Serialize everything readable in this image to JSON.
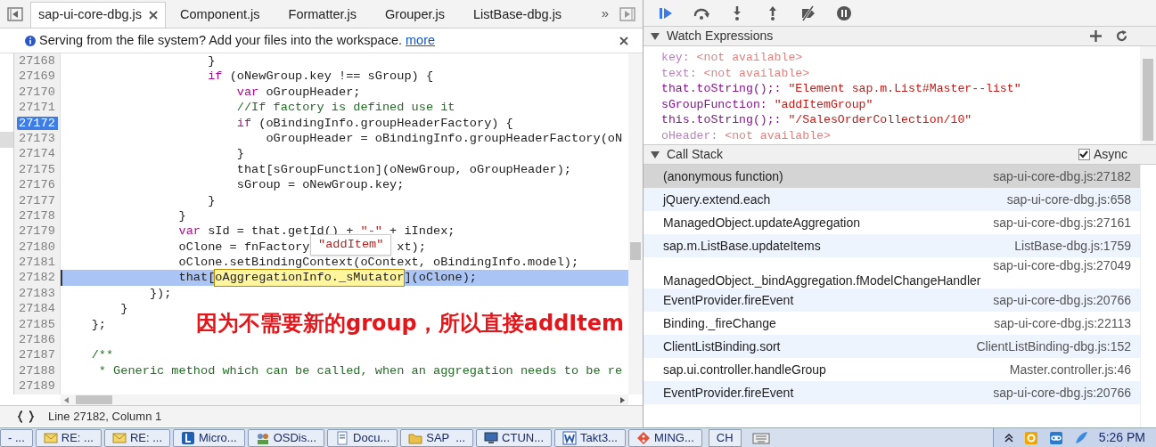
{
  "tabs": [
    {
      "label": "sap-ui-core-dbg.js",
      "selected": true
    },
    {
      "label": "Component.js",
      "selected": false
    },
    {
      "label": "Formatter.js",
      "selected": false
    },
    {
      "label": "Grouper.js",
      "selected": false
    },
    {
      "label": "ListBase-dbg.js",
      "selected": false
    }
  ],
  "tab_overflow": "»",
  "info_bar": {
    "text": "Serving from the file system? Add your files into the workspace.",
    "link": "more"
  },
  "code": {
    "lines": [
      {
        "number": "27168",
        "breakpoint": false,
        "current": false,
        "segments": [
          {
            "t": "                    }",
            "kind": "plain"
          }
        ]
      },
      {
        "number": "27169",
        "breakpoint": false,
        "current": false,
        "segments": [
          {
            "t": "                    if",
            "kind": "keyword"
          },
          {
            "t": " (oNewGroup.key !== sGroup) {",
            "kind": "plain"
          }
        ]
      },
      {
        "number": "27170",
        "breakpoint": false,
        "current": false,
        "segments": [
          {
            "t": "                        var",
            "kind": "keyword"
          },
          {
            "t": " oGroupHeader;",
            "kind": "plain"
          }
        ]
      },
      {
        "number": "27171",
        "breakpoint": false,
        "current": false,
        "segments": [
          {
            "t": "                        //If factory is defined use it",
            "kind": "comment"
          }
        ]
      },
      {
        "number": "27172",
        "breakpoint": true,
        "current": false,
        "segments": [
          {
            "t": "                        if",
            "kind": "keyword"
          },
          {
            "t": " (oBindingInfo.groupHeaderFactory) {",
            "kind": "plain"
          }
        ]
      },
      {
        "number": "27173",
        "breakpoint": false,
        "current": false,
        "segments": [
          {
            "t": "                            oGroupHeader = oBindingInfo.groupHeaderFactory(oN",
            "kind": "plain"
          }
        ]
      },
      {
        "number": "27174",
        "breakpoint": false,
        "current": false,
        "segments": [
          {
            "t": "                        }",
            "kind": "plain"
          }
        ]
      },
      {
        "number": "27175",
        "breakpoint": false,
        "current": false,
        "segments": [
          {
            "t": "                        that[sGroupFunction](oNewGroup, oGroupHeader);",
            "kind": "plain"
          }
        ]
      },
      {
        "number": "27176",
        "breakpoint": false,
        "current": false,
        "segments": [
          {
            "t": "                        sGroup = oNewGroup.key;",
            "kind": "plain"
          }
        ]
      },
      {
        "number": "27177",
        "breakpoint": false,
        "current": false,
        "segments": [
          {
            "t": "                    }",
            "kind": "plain"
          }
        ]
      },
      {
        "number": "27178",
        "breakpoint": false,
        "current": false,
        "segments": [
          {
            "t": "                }",
            "kind": "plain"
          }
        ]
      },
      {
        "number": "27179",
        "breakpoint": false,
        "current": false,
        "segments": [
          {
            "t": "                var",
            "kind": "keyword"
          },
          {
            "t": " sId = that.getId() + ",
            "kind": "plain"
          },
          {
            "t": "\"-\"",
            "kind": "string"
          },
          {
            "t": " + iIndex;",
            "kind": "plain"
          }
        ]
      },
      {
        "number": "27180",
        "breakpoint": false,
        "current": false,
        "popup": "\"addItem\"",
        "segments": [
          {
            "t": "                oClone = fnFactory",
            "kind": "plain"
          },
          {
            "t": "xt);",
            "kind": "plain",
            "covered": true
          }
        ]
      },
      {
        "number": "27181",
        "breakpoint": false,
        "current": false,
        "segments": [
          {
            "t": "                oClone.setBindingContext(oContext, oBindingInfo.model);",
            "kind": "plain"
          }
        ]
      },
      {
        "number": "27182",
        "breakpoint": false,
        "current": true,
        "segments": [
          {
            "t": "                that[",
            "kind": "plain"
          },
          {
            "t": "oAggregationInfo._sMutator",
            "kind": "highlight"
          },
          {
            "t": "](oClone);",
            "kind": "plain"
          }
        ]
      },
      {
        "number": "27183",
        "breakpoint": false,
        "current": false,
        "segments": [
          {
            "t": "            });",
            "kind": "plain"
          }
        ]
      },
      {
        "number": "27184",
        "breakpoint": false,
        "current": false,
        "segments": [
          {
            "t": "        }",
            "kind": "plain"
          }
        ]
      },
      {
        "number": "27185",
        "breakpoint": false,
        "current": false,
        "segments": [
          {
            "t": "    };",
            "kind": "plain"
          }
        ]
      },
      {
        "number": "27186",
        "breakpoint": false,
        "current": false
      },
      {
        "number": "27187",
        "breakpoint": false,
        "current": false,
        "segments": [
          {
            "t": "    /**",
            "kind": "comment"
          }
        ]
      },
      {
        "number": "27188",
        "breakpoint": false,
        "current": false,
        "segments": [
          {
            "t": "     * Generic method which can be called, when an aggregation needs to be re",
            "kind": "comment"
          }
        ]
      },
      {
        "number": "27189",
        "breakpoint": false,
        "current": false
      }
    ]
  },
  "status_bar": {
    "position": "Line 27182, Column 1"
  },
  "annotation": "因为不需要新的group，所以直接addItem",
  "debugger_toolbar": [
    {
      "kind": "resume",
      "active": true
    },
    {
      "kind": "step-over",
      "active": false
    },
    {
      "kind": "step-into",
      "active": false
    },
    {
      "kind": "step-out",
      "active": false
    },
    {
      "kind": "deactivate-breakpoints",
      "active": false
    },
    {
      "kind": "pause-exceptions",
      "active": false
    }
  ],
  "watch": {
    "title": "Watch Expressions",
    "items": [
      {
        "name": "key:",
        "value": "<not available>",
        "available": false
      },
      {
        "name": "text:",
        "value": "<not available>",
        "available": false
      },
      {
        "name": "that.toString();:",
        "value": "\"Element sap.m.List#Master--list\"",
        "available": true
      },
      {
        "name": "sGroupFunction:",
        "value": "\"addItemGroup\"",
        "available": true
      },
      {
        "name": "this.toString();:",
        "value": "\"/SalesOrderCollection/10\"",
        "available": true
      },
      {
        "name": "oHeader:",
        "value": "<not available>",
        "available": false
      }
    ]
  },
  "call_stack": {
    "title": "Call Stack",
    "async": {
      "label": "Async",
      "checked": true
    },
    "frames": [
      {
        "function": "(anonymous function)",
        "location": "sap-ui-core-dbg.js:27182",
        "selected": true,
        "wrapped": false
      },
      {
        "function": "jQuery.extend.each",
        "location": "sap-ui-core-dbg.js:658",
        "selected": false,
        "wrapped": false
      },
      {
        "function": "ManagedObject.updateAggregation",
        "location": "sap-ui-core-dbg.js:27161",
        "selected": false,
        "wrapped": false
      },
      {
        "function": "sap.m.ListBase.updateItems",
        "location": "ListBase-dbg.js:1759",
        "selected": false,
        "wrapped": false
      },
      {
        "function": "ManagedObject._bindAggregation.fModelChangeHandler",
        "location": "sap-ui-core-dbg.js:27049",
        "selected": false,
        "wrapped": true
      },
      {
        "function": "EventProvider.fireEvent",
        "location": "sap-ui-core-dbg.js:20766",
        "selected": false,
        "wrapped": false
      },
      {
        "function": "Binding._fireChange",
        "location": "sap-ui-core-dbg.js:22113",
        "selected": false,
        "wrapped": false
      },
      {
        "function": "ClientListBinding.sort",
        "location": "ClientListBinding-dbg.js:152",
        "selected": false,
        "wrapped": false
      },
      {
        "function": "sap.ui.controller.handleGroup",
        "location": "Master.controller.js:46",
        "selected": false,
        "wrapped": false
      },
      {
        "function": "EventProvider.fireEvent",
        "location": "sap-ui-core-dbg.js:20766",
        "selected": false,
        "wrapped": false
      }
    ]
  },
  "taskbar": {
    "items": [
      {
        "label": "- ...",
        "kind": "plain"
      },
      {
        "label": "RE: ...",
        "kind": "mail"
      },
      {
        "label": "RE: ...",
        "kind": "mail"
      },
      {
        "label": "Micro...",
        "kind": "app"
      },
      {
        "label": "OSDis...",
        "kind": "people"
      },
      {
        "label": "Docu...",
        "kind": "doc"
      },
      {
        "label": "SAP  ...",
        "kind": "folder"
      },
      {
        "label": "CTUN...",
        "kind": "monitor"
      },
      {
        "label": "Takt3...",
        "kind": "word"
      },
      {
        "label": "MING...",
        "kind": "git"
      }
    ],
    "language": "CH",
    "clock": "5:26 PM"
  }
}
